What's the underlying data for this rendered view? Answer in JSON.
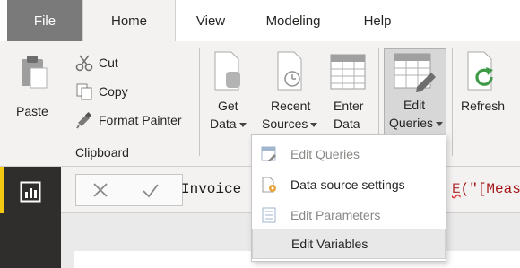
{
  "tabs": {
    "file": "File",
    "home": "Home",
    "view": "View",
    "modeling": "Modeling",
    "help": "Help"
  },
  "clipboard": {
    "paste": "Paste",
    "cut": "Cut",
    "copy": "Copy",
    "format_painter": "Format Painter",
    "group_label": "Clipboard"
  },
  "external_data": {
    "get_data_line1": "Get",
    "get_data_line2": "Data",
    "recent_sources_line1": "Recent",
    "recent_sources_line2": "Sources",
    "enter_data_line1": "Enter",
    "enter_data_line2": "Data",
    "edit_queries_line1": "Edit",
    "edit_queries_line2": "Queries",
    "refresh": "Refresh"
  },
  "formula_bar": {
    "text_left": "Invoice",
    "text_right_func": "E",
    "text_right_rest": "(\"[Measu"
  },
  "dropdown": {
    "items": [
      {
        "label": "Edit Queries",
        "icon": "edit-queries-icon",
        "disabled": true
      },
      {
        "label": "Data source settings",
        "icon": "data-source-settings-icon",
        "disabled": false
      },
      {
        "label": "Edit Parameters",
        "icon": "edit-parameters-icon",
        "disabled": true
      },
      {
        "label": "Edit Variables",
        "icon": "",
        "disabled": false,
        "highlighted": true
      }
    ]
  },
  "colors": {
    "ribbon_bg": "#f3f2f1",
    "file_tab_bg": "#7a7a7a",
    "left_nav_bg": "#2f2e2d",
    "accent_yellow": "#f2c811",
    "menu_highlight": "#e8e8e8",
    "refresh_green": "#4caf50"
  }
}
